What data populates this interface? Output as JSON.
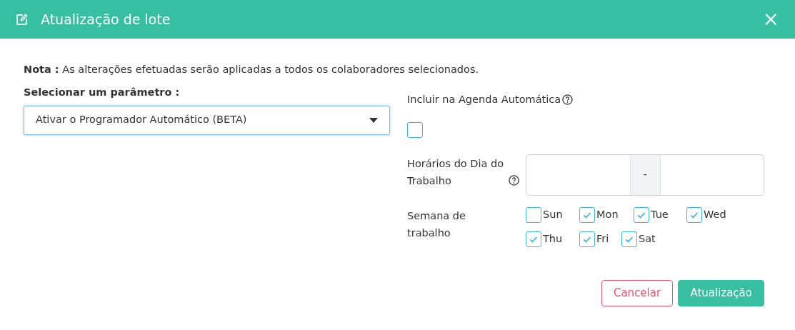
{
  "modal": {
    "title": "Atualização de lote",
    "close": "×"
  },
  "note": {
    "label": "Nota :",
    "text": "As alterações efetuadas serão aplicadas a todos os colaboradores selecionados."
  },
  "parameter": {
    "label": "Selecionar um parâmetro :",
    "value": "Ativar o Programador Automático (BETA)"
  },
  "auto_schedule": {
    "label": "Incluir na Agenda Automática",
    "checked": false
  },
  "work_hours": {
    "label": "Horários do Dia do Trabalho",
    "separator": "-"
  },
  "work_week": {
    "label": "Semana de trabalho",
    "days": [
      {
        "label": "Sun",
        "checked": false
      },
      {
        "label": "Mon",
        "checked": true
      },
      {
        "label": "Tue",
        "checked": true
      },
      {
        "label": "Wed",
        "checked": true
      },
      {
        "label": "Thu",
        "checked": true
      },
      {
        "label": "Fri",
        "checked": true
      },
      {
        "label": "Sat",
        "checked": true
      }
    ]
  },
  "buttons": [
    {
      "label": "Cancelar",
      "kind": "cancel"
    },
    {
      "label": "Atualização",
      "kind": "primary"
    }
  ]
}
